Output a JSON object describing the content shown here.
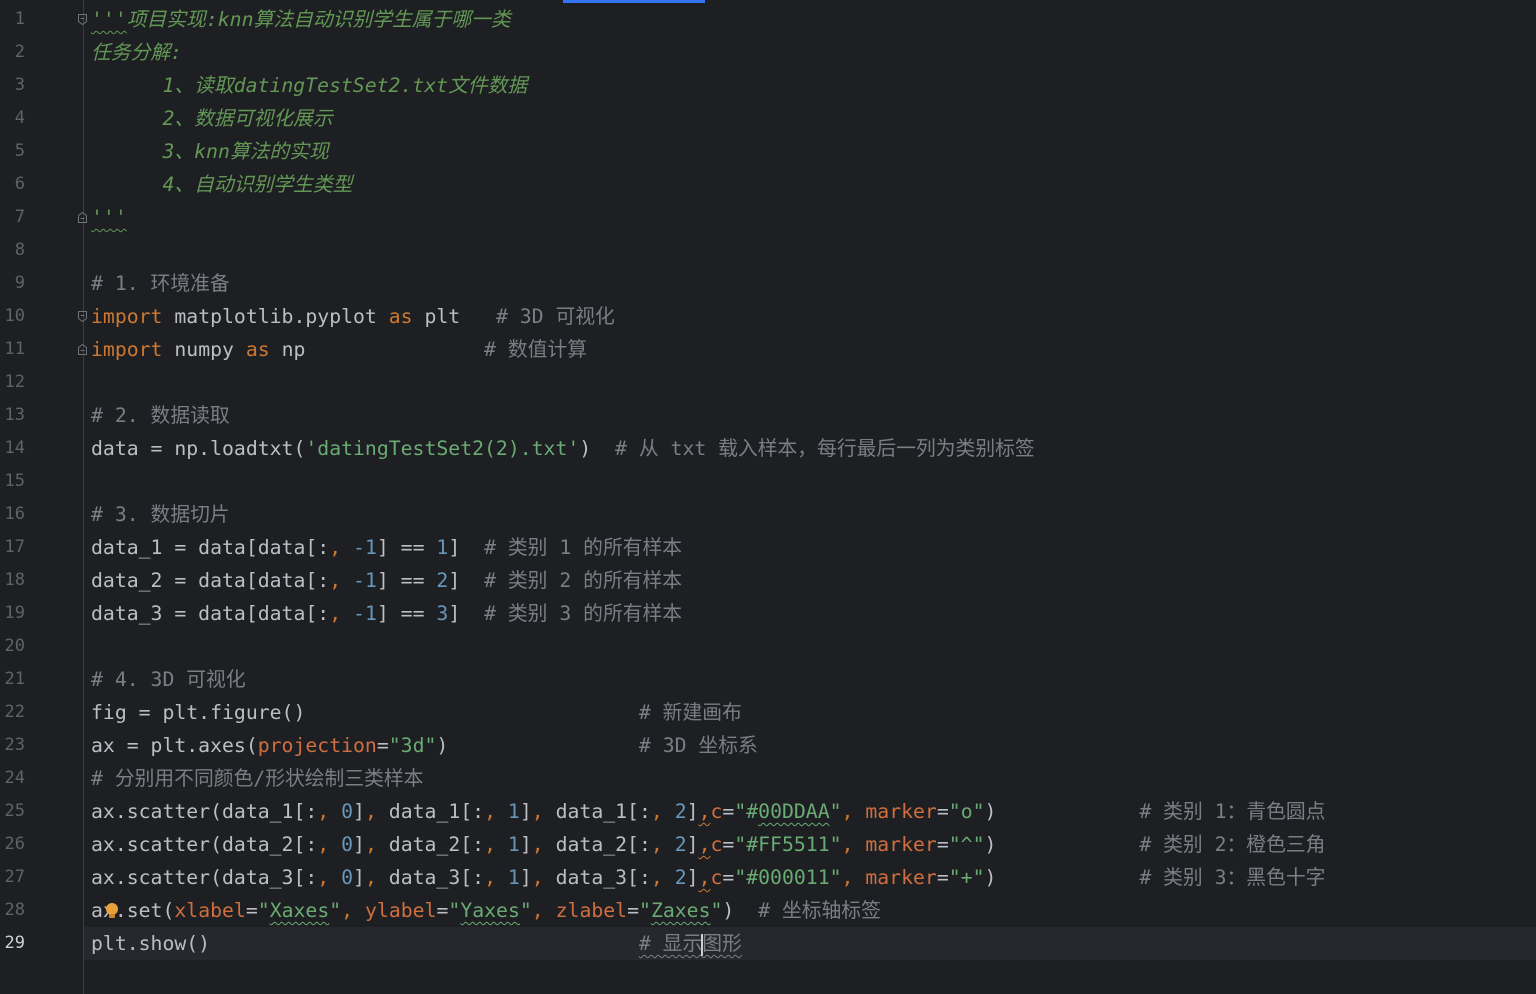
{
  "editor": {
    "current_line": 29,
    "lines": [
      {
        "number": "1",
        "tokens": [
          {
            "t": "'''",
            "c": "#629755",
            "i": true,
            "u": true
          },
          {
            "t": "项目实现:knn算法自动识别学生属于哪一类",
            "c": "#629755",
            "i": true
          }
        ]
      },
      {
        "number": "2",
        "tokens": [
          {
            "t": "任务分解:",
            "c": "#629755",
            "i": true
          }
        ]
      },
      {
        "number": "3",
        "tokens": [
          {
            "t": "      1、读取datingTestSet2.txt文件数据",
            "c": "#629755",
            "i": true
          }
        ]
      },
      {
        "number": "4",
        "tokens": [
          {
            "t": "      2、数据可视化展示",
            "c": "#629755",
            "i": true
          }
        ]
      },
      {
        "number": "5",
        "tokens": [
          {
            "t": "      3、knn算法的实现",
            "c": "#629755",
            "i": true
          }
        ]
      },
      {
        "number": "6",
        "tokens": [
          {
            "t": "      4、自动识别学生类型",
            "c": "#629755",
            "i": true
          }
        ]
      },
      {
        "number": "7",
        "tokens": [
          {
            "t": "'''",
            "c": "#629755",
            "i": true,
            "u": true
          }
        ]
      },
      {
        "number": "8",
        "tokens": []
      },
      {
        "number": "9",
        "tokens": [
          {
            "t": "# 1. 环境准备",
            "c": "#7a7e85"
          }
        ]
      },
      {
        "number": "10",
        "tokens": [
          {
            "t": "import",
            "c": "#cc7832"
          },
          {
            "t": " matplotlib.pyplot "
          },
          {
            "t": "as",
            "c": "#cc7832"
          },
          {
            "t": " plt   "
          },
          {
            "t": "# 3D 可视化",
            "c": "#7a7e85"
          }
        ]
      },
      {
        "number": "11",
        "tokens": [
          {
            "t": "import",
            "c": "#cc7832"
          },
          {
            "t": " numpy "
          },
          {
            "t": "as",
            "c": "#cc7832"
          },
          {
            "t": " np"
          },
          {
            "t": "               "
          },
          {
            "t": "# 数值计算",
            "c": "#7a7e85"
          }
        ]
      },
      {
        "number": "12",
        "tokens": []
      },
      {
        "number": "13",
        "tokens": [
          {
            "t": "# 2. 数据读取",
            "c": "#7a7e85"
          }
        ]
      },
      {
        "number": "14",
        "tokens": [
          {
            "t": "data = np.loadtxt("
          },
          {
            "t": "'datingTestSet2(2).txt'",
            "c": "#6aab73"
          },
          {
            "t": ")  "
          },
          {
            "t": "# 从 txt 载入样本，每行最后一列为类别标签",
            "c": "#7a7e85"
          }
        ]
      },
      {
        "number": "15",
        "tokens": []
      },
      {
        "number": "16",
        "tokens": [
          {
            "t": "# 3. 数据切片",
            "c": "#7a7e85"
          }
        ]
      },
      {
        "number": "17",
        "tokens": [
          {
            "t": "data_1 = data[data[:"
          },
          {
            "t": ",",
            "c": "#cc7832"
          },
          {
            "t": " "
          },
          {
            "t": "-1",
            "c": "#6897bb"
          },
          {
            "t": "] == "
          },
          {
            "t": "1",
            "c": "#6897bb"
          },
          {
            "t": "]  "
          },
          {
            "t": "# 类别 1 的所有样本",
            "c": "#7a7e85"
          }
        ]
      },
      {
        "number": "18",
        "tokens": [
          {
            "t": "data_2 = data[data[:"
          },
          {
            "t": ",",
            "c": "#cc7832"
          },
          {
            "t": " "
          },
          {
            "t": "-1",
            "c": "#6897bb"
          },
          {
            "t": "] == "
          },
          {
            "t": "2",
            "c": "#6897bb"
          },
          {
            "t": "]  "
          },
          {
            "t": "# 类别 2 的所有样本",
            "c": "#7a7e85"
          }
        ]
      },
      {
        "number": "19",
        "tokens": [
          {
            "t": "data_3 = data[data[:"
          },
          {
            "t": ",",
            "c": "#cc7832"
          },
          {
            "t": " "
          },
          {
            "t": "-1",
            "c": "#6897bb"
          },
          {
            "t": "] == "
          },
          {
            "t": "3",
            "c": "#6897bb"
          },
          {
            "t": "]  "
          },
          {
            "t": "# 类别 3 的所有样本",
            "c": "#7a7e85"
          }
        ]
      },
      {
        "number": "20",
        "tokens": []
      },
      {
        "number": "21",
        "tokens": [
          {
            "t": "# 4. 3D 可视化",
            "c": "#7a7e85"
          }
        ]
      },
      {
        "number": "22",
        "tokens": [
          {
            "t": "fig = plt.figure()"
          },
          {
            "t": "                            "
          },
          {
            "t": "# 新建画布",
            "c": "#7a7e85"
          }
        ]
      },
      {
        "number": "23",
        "tokens": [
          {
            "t": "ax = plt.axes("
          },
          {
            "t": "projection",
            "c": "#cf6f3f"
          },
          {
            "t": "="
          },
          {
            "t": "\"3d\"",
            "c": "#6aab73"
          },
          {
            "t": ")"
          },
          {
            "t": "                "
          },
          {
            "t": "# 3D 坐标系",
            "c": "#7a7e85"
          }
        ]
      },
      {
        "number": "24",
        "tokens": [
          {
            "t": "# 分别用不同颜色/形状绘制三类样本",
            "c": "#7a7e85"
          }
        ]
      },
      {
        "number": "25",
        "tokens": [
          {
            "t": "ax.scatter(data_1[:"
          },
          {
            "t": ",",
            "c": "#cc7832"
          },
          {
            "t": " "
          },
          {
            "t": "0",
            "c": "#6897bb"
          },
          {
            "t": "]"
          },
          {
            "t": ",",
            "c": "#cc7832"
          },
          {
            "t": " data_1[:"
          },
          {
            "t": ",",
            "c": "#cc7832"
          },
          {
            "t": " "
          },
          {
            "t": "1",
            "c": "#6897bb"
          },
          {
            "t": "]"
          },
          {
            "t": ",",
            "c": "#cc7832"
          },
          {
            "t": " data_1[:"
          },
          {
            "t": ",",
            "c": "#cc7832"
          },
          {
            "t": " "
          },
          {
            "t": "2",
            "c": "#6897bb"
          },
          {
            "t": "]"
          },
          {
            "t": ",",
            "c": "#cc7832",
            "u": true
          },
          {
            "t": "c",
            "c": "#cf6f3f"
          },
          {
            "t": "="
          },
          {
            "t": "\"#",
            "c": "#6aab73"
          },
          {
            "t": "00DDAA",
            "c": "#6aab73",
            "u": true
          },
          {
            "t": "\"",
            "c": "#6aab73"
          },
          {
            "t": ",",
            "c": "#cc7832"
          },
          {
            "t": " "
          },
          {
            "t": "marker",
            "c": "#cf6f3f"
          },
          {
            "t": "="
          },
          {
            "t": "\"o\"",
            "c": "#6aab73"
          },
          {
            "t": ")"
          },
          {
            "t": "            "
          },
          {
            "t": "# 类别 1：青色圆点",
            "c": "#7a7e85"
          }
        ]
      },
      {
        "number": "26",
        "tokens": [
          {
            "t": "ax.scatter(data_2[:"
          },
          {
            "t": ",",
            "c": "#cc7832"
          },
          {
            "t": " "
          },
          {
            "t": "0",
            "c": "#6897bb"
          },
          {
            "t": "]"
          },
          {
            "t": ",",
            "c": "#cc7832"
          },
          {
            "t": " data_2[:"
          },
          {
            "t": ",",
            "c": "#cc7832"
          },
          {
            "t": " "
          },
          {
            "t": "1",
            "c": "#6897bb"
          },
          {
            "t": "]"
          },
          {
            "t": ",",
            "c": "#cc7832"
          },
          {
            "t": " data_2[:"
          },
          {
            "t": ",",
            "c": "#cc7832"
          },
          {
            "t": " "
          },
          {
            "t": "2",
            "c": "#6897bb"
          },
          {
            "t": "]"
          },
          {
            "t": ",",
            "c": "#cc7832",
            "u": true
          },
          {
            "t": "c",
            "c": "#cf6f3f"
          },
          {
            "t": "="
          },
          {
            "t": "\"#FF5511\"",
            "c": "#6aab73"
          },
          {
            "t": ",",
            "c": "#cc7832"
          },
          {
            "t": " "
          },
          {
            "t": "marker",
            "c": "#cf6f3f"
          },
          {
            "t": "="
          },
          {
            "t": "\"^\"",
            "c": "#6aab73"
          },
          {
            "t": ")"
          },
          {
            "t": "            "
          },
          {
            "t": "# 类别 2：橙色三角",
            "c": "#7a7e85"
          }
        ]
      },
      {
        "number": "27",
        "tokens": [
          {
            "t": "ax.scatter(data_3[:"
          },
          {
            "t": ",",
            "c": "#cc7832"
          },
          {
            "t": " "
          },
          {
            "t": "0",
            "c": "#6897bb"
          },
          {
            "t": "]"
          },
          {
            "t": ",",
            "c": "#cc7832"
          },
          {
            "t": " data_3[:"
          },
          {
            "t": ",",
            "c": "#cc7832"
          },
          {
            "t": " "
          },
          {
            "t": "1",
            "c": "#6897bb"
          },
          {
            "t": "]"
          },
          {
            "t": ",",
            "c": "#cc7832"
          },
          {
            "t": " data_3[:"
          },
          {
            "t": ",",
            "c": "#cc7832"
          },
          {
            "t": " "
          },
          {
            "t": "2",
            "c": "#6897bb"
          },
          {
            "t": "]"
          },
          {
            "t": ",",
            "c": "#cc7832",
            "u": true
          },
          {
            "t": "c",
            "c": "#cf6f3f"
          },
          {
            "t": "="
          },
          {
            "t": "\"#000011\"",
            "c": "#6aab73"
          },
          {
            "t": ",",
            "c": "#cc7832"
          },
          {
            "t": " "
          },
          {
            "t": "marker",
            "c": "#cf6f3f"
          },
          {
            "t": "="
          },
          {
            "t": "\"+\"",
            "c": "#6aab73"
          },
          {
            "t": ")"
          },
          {
            "t": "            "
          },
          {
            "t": "# 类别 3：黑色十字",
            "c": "#7a7e85"
          }
        ]
      },
      {
        "number": "28",
        "tokens": [
          {
            "t": "ax.set("
          },
          {
            "t": "xlabel",
            "c": "#cf6f3f"
          },
          {
            "t": "="
          },
          {
            "t": "\"",
            "c": "#6aab73"
          },
          {
            "t": "Xaxes",
            "c": "#6aab73",
            "u": true
          },
          {
            "t": "\"",
            "c": "#6aab73"
          },
          {
            "t": ",",
            "c": "#cc7832"
          },
          {
            "t": " "
          },
          {
            "t": "ylabel",
            "c": "#cf6f3f"
          },
          {
            "t": "="
          },
          {
            "t": "\"",
            "c": "#6aab73"
          },
          {
            "t": "Yaxes",
            "c": "#6aab73",
            "u": true
          },
          {
            "t": "\"",
            "c": "#6aab73"
          },
          {
            "t": ",",
            "c": "#cc7832"
          },
          {
            "t": " "
          },
          {
            "t": "zlabel",
            "c": "#cf6f3f"
          },
          {
            "t": "="
          },
          {
            "t": "\"",
            "c": "#6aab73"
          },
          {
            "t": "Zaxes",
            "c": "#6aab73",
            "u": true
          },
          {
            "t": "\"",
            "c": "#6aab73"
          },
          {
            "t": ")  "
          },
          {
            "t": "# 坐标轴标签",
            "c": "#7a7e85"
          }
        ]
      },
      {
        "number": "29",
        "tokens": [
          {
            "t": "plt.show()"
          },
          {
            "t": "                                    "
          },
          {
            "t": "# 显示",
            "c": "#7a7e85",
            "u": true
          },
          {
            "caret": true
          },
          {
            "t": "图形",
            "c": "#7a7e85",
            "u": true
          }
        ]
      }
    ]
  },
  "colors": {
    "background": "#1e1f22",
    "current_line": "#26282e",
    "default_text": "#bcbec4",
    "line_number": "#606366",
    "accent": "#3574f0",
    "bulb": "#e9a23b"
  }
}
